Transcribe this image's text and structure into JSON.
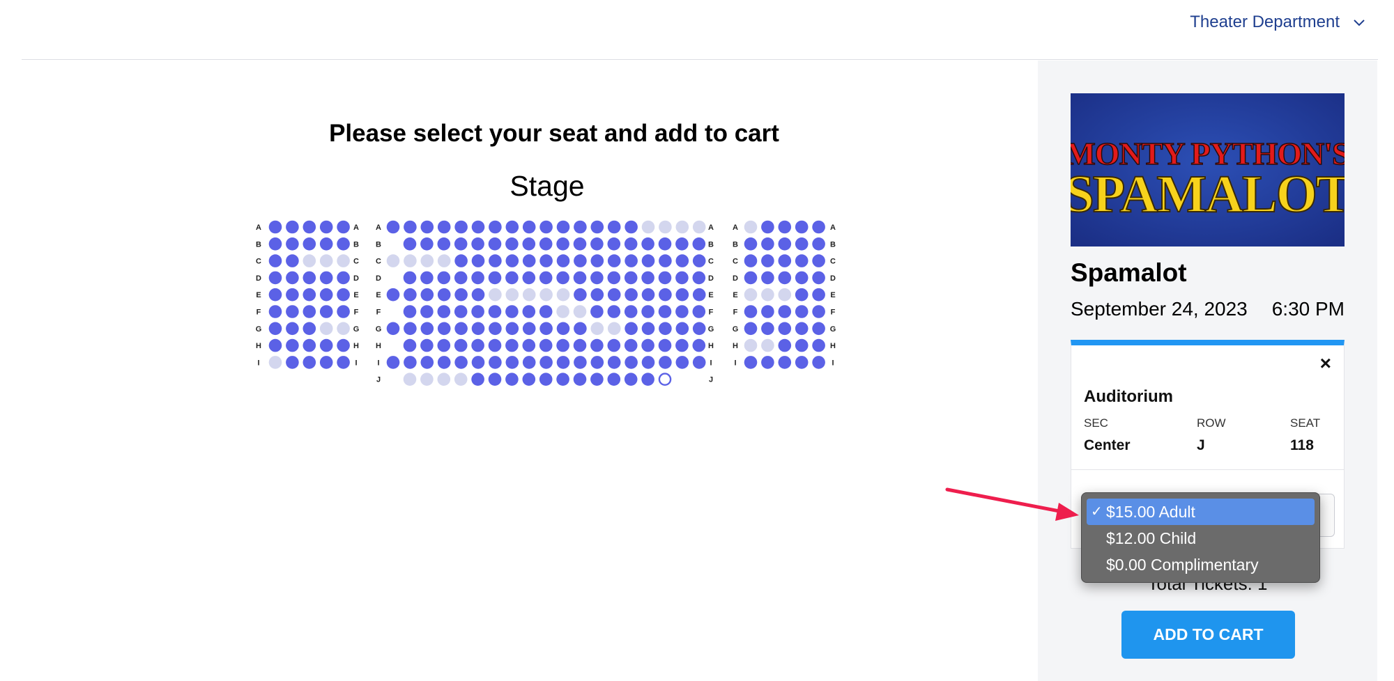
{
  "header": {
    "org_label": "Theater Department"
  },
  "main": {
    "title": "Please select your seat and add to cart",
    "stage_label": "Stage"
  },
  "seat_map": {
    "colors": {
      "available": "#5b61e6",
      "unavailable": "#d3d6ee",
      "selected_outline": "#5b61e6"
    },
    "sections": [
      {
        "name": "Left",
        "rows": {
          "A": "XXXXX",
          "B": "XXXXX",
          "C": "XXOOO",
          "D": "XXXXX",
          "E": "XXXXX",
          "F": "XXXXX",
          "G": "XXXOO",
          "H": "XXXXX",
          "I": "OXXXX"
        }
      },
      {
        "name": "Center",
        "rows": {
          "A": "XXXXXXXXXXXXXXXOOOO",
          "B": "XXXXXXXXXXXXXXXXXX",
          "C": "OOOOXXXXXXXXXXXXXXX",
          "D": "XXXXXXXXXXXXXXXXXX",
          "E": "XXXXXXOOOOOXXXXXXXX",
          "F": "XXXXXXXXXOOXXXXXXX",
          "G": "XXXXXXXXXXXXOOXXXXX",
          "H": "XXXXXXXXXXXXXXXXXX",
          "I": "XXXXXXXXXXXXXXXXXXX",
          "J": "OOOOXXXXXXXXXXXS"
        }
      },
      {
        "name": "Right",
        "rows": {
          "A": "OXXXX",
          "B": "XXXXX",
          "C": "XXXXX",
          "D": "XXXXX",
          "E": "OOOXX",
          "F": "XXXXX",
          "G": "XXXXX",
          "H": "OOXXX",
          "I": "XXXXX"
        }
      }
    ]
  },
  "event": {
    "poster_line_1": "MONTY PYTHON'S",
    "poster_line_2": "SPAMALOT",
    "title": "Spamalot",
    "date": "September 24, 2023",
    "time": "6:30 PM"
  },
  "ticket": {
    "close_icon": "×",
    "venue": "Auditorium",
    "headers": {
      "sec": "SEC",
      "row": "ROW",
      "seat": "SEAT"
    },
    "values": {
      "sec": "Center",
      "row": "J",
      "seat": "118"
    }
  },
  "price_dropdown": {
    "options": [
      {
        "label": "$15.00 Adult",
        "selected": true
      },
      {
        "label": "$12.00 Child",
        "selected": false
      },
      {
        "label": "$0.00 Complimentary",
        "selected": false
      }
    ],
    "check_glyph": "✓"
  },
  "summary": {
    "total_label": "Total Tickets: 1"
  },
  "cart": {
    "button_label": "ADD TO CART"
  },
  "annotation": {
    "arrow_color": "#ee1e4d"
  }
}
